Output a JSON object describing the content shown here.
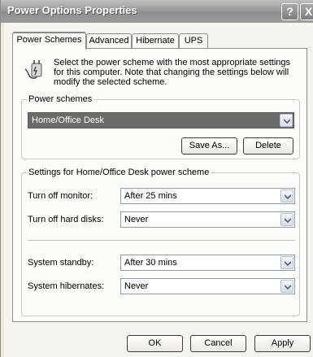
{
  "window": {
    "title": "Power Options Properties",
    "help_glyph": "?",
    "close_glyph": "X"
  },
  "tabs": [
    {
      "label": "Power Schemes",
      "active": true
    },
    {
      "label": "Advanced",
      "active": false
    },
    {
      "label": "Hibernate",
      "active": false
    },
    {
      "label": "UPS",
      "active": false
    }
  ],
  "intro": {
    "icon": "power-plug-icon",
    "text": "Select the power scheme with the most appropriate settings for this computer. Note that changing the settings below will modify the selected scheme."
  },
  "power_schemes": {
    "legend": "Power schemes",
    "selected": "Home/Office Desk",
    "save_as_label": "Save As...",
    "delete_label": "Delete"
  },
  "settings": {
    "legend": "Settings for Home/Office Desk power scheme",
    "rows": [
      {
        "label": "Turn off monitor:",
        "value": "After 25 mins"
      },
      {
        "label": "Turn off hard disks:",
        "value": "Never"
      },
      {
        "label": "System standby:",
        "value": "After 30 mins"
      },
      {
        "label": "System hibernates:",
        "value": "Never"
      }
    ]
  },
  "footer": {
    "ok_label": "OK",
    "cancel_label": "Cancel",
    "apply_label": "Apply"
  },
  "colors": {
    "titlebar": "#9a9a9a",
    "selection": "#6b6b6b"
  }
}
